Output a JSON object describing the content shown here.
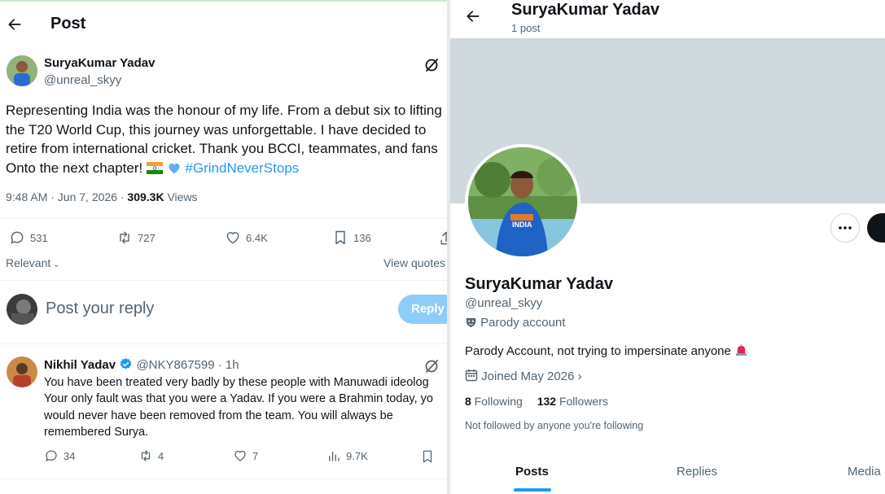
{
  "post_view": {
    "header_title": "Post",
    "tweet": {
      "display_name": "SuryaKumar Yadav",
      "handle": "@unreal_skyy",
      "text_lines": [
        "Representing India was the honour of my life. From a debut six to lifting",
        "the T20 World Cup, this journey was unforgettable. I have decided to",
        "retire from international cricket. Thank you BCCI, teammates, and fans",
        "Onto the next chapter! "
      ],
      "hashtag": "#GrindNeverStops",
      "timestamp": "9:48 AM · Jun 7, 2026 · ",
      "views_count": "309.3K",
      "views_label": " Views",
      "replies": "531",
      "reposts": "727",
      "likes": "6.4K",
      "bookmarks": "136"
    },
    "sort_label": "Relevant",
    "view_quotes": "View quotes",
    "compose_placeholder": "Post your reply",
    "reply_button": "Reply",
    "reply": {
      "display_name": "Nikhil Yadav",
      "handle_time": "@NKY867599 · 1h",
      "text_lines": [
        "You have been treated very badly by these people with Manuwadi ideolog",
        "Your only fault was that you were a Yadav. If you were a Brahmin today, yo",
        "would never have been removed from the team. You will always be",
        "remembered Surya."
      ],
      "replies": "34",
      "reposts": "4",
      "likes": "7",
      "views": "9.7K"
    }
  },
  "profile_view": {
    "header_name": "SuryaKumar Yadav",
    "header_posts": "1 post",
    "display_name": "SuryaKumar Yadav",
    "handle": "@unreal_skyy",
    "parody_label": "Parody account",
    "bio": "Parody Account, not trying to impersinate anyone ",
    "joined": "Joined May 2026",
    "following_count": "8",
    "following_label": " Following",
    "followers_count": "132",
    "followers_label": " Followers",
    "not_followed": "Not followed by anyone you're following",
    "tabs": [
      "Posts",
      "Replies",
      "Media"
    ]
  },
  "colors": {
    "accent": "#1d9bf0",
    "muted": "#536471",
    "banner": "#cfd9de",
    "jersey": "#1f63c4",
    "alert": "#e0245e"
  },
  "icons": {
    "back": "arrow-left-icon",
    "grok": "grok-icon",
    "reply": "speech-bubble-icon",
    "repost": "repost-icon",
    "like": "heart-icon",
    "bookmark": "bookmark-icon",
    "views": "bar-chart-icon",
    "verified": "verified-badge-icon",
    "more": "more-dots-icon",
    "calendar": "calendar-icon",
    "shield": "parody-mask-icon",
    "siren": "siren-emoji-icon"
  }
}
